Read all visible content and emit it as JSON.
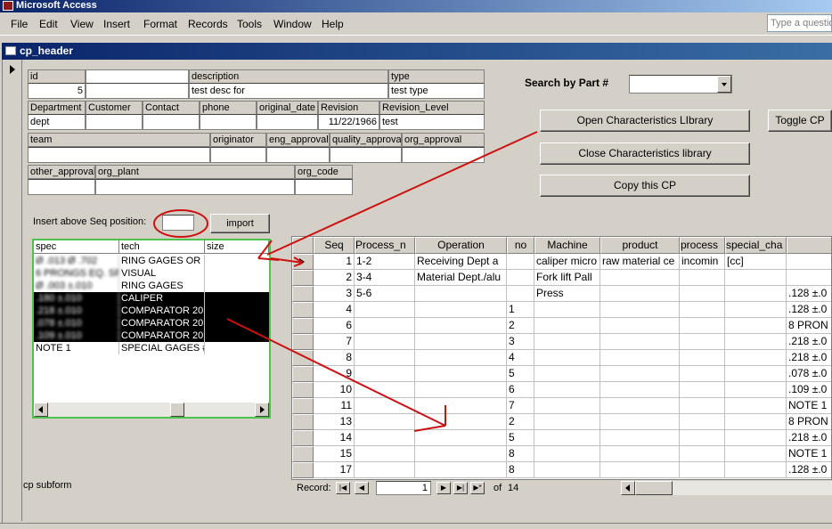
{
  "app": {
    "title": "Microsoft Access",
    "help_placeholder": "Type a questio"
  },
  "menu": [
    {
      "label": "File"
    },
    {
      "label": "Edit"
    },
    {
      "label": "View"
    },
    {
      "label": "Insert"
    },
    {
      "label": "Format"
    },
    {
      "label": "Records"
    },
    {
      "label": "Tools"
    },
    {
      "label": "Window"
    },
    {
      "label": "Help"
    }
  ],
  "window": {
    "title": "cp_header"
  },
  "header": {
    "labels": {
      "id": "id",
      "description": "description",
      "type": "type",
      "department": "Department",
      "customer": "Customer",
      "contact": "Contact",
      "phone": "phone",
      "original_date": "original_date",
      "revision": "Revision",
      "revision_level": "Revision_Level",
      "team": "team",
      "originator": "originator",
      "eng_approval": "eng_approval",
      "quality_approval": "quality_approval",
      "org_approval": "org_approval",
      "other_approval": "other_approval",
      "org_plant": "org_plant",
      "org_code": "org_code"
    },
    "values": {
      "id": "5",
      "part_no": "",
      "part_no_2": "",
      "description": "test desc for",
      "type": "test type",
      "department": "dept",
      "customer": "",
      "contact": "",
      "phone": "",
      "original_date": "",
      "revision": "11/22/1966",
      "revision_level": "test",
      "team": "",
      "originator": "",
      "eng_approval": "",
      "quality_approval": "",
      "org_approval": "",
      "other_approval": "",
      "org_plant": "",
      "org_code": ""
    }
  },
  "search": {
    "label": "Search by Part #",
    "value": ""
  },
  "buttons": {
    "open_library": "Open Characteristics LIbrary",
    "close_library": "Close Characteristics library",
    "copy_cp": "Copy this CP",
    "toggle_cp": "Toggle CP",
    "import": "import"
  },
  "insert": {
    "label": "Insert above Seq position:",
    "value": ""
  },
  "listbox": {
    "columns": [
      "spec",
      "tech",
      "size"
    ],
    "rows": [
      {
        "spec": "Ø .013 Ø .702",
        "tech": "RING GAGES OR I",
        "size": "",
        "selected": false,
        "blurred": true
      },
      {
        "spec": "6 PRONGS EQ. SF",
        "tech": "VISUAL",
        "size": "",
        "selected": false,
        "blurred": true
      },
      {
        "spec": "Ø .003 ±.010",
        "tech": "RING GAGES",
        "size": "",
        "selected": false,
        "blurred": true
      },
      {
        "spec": ".180 ±.010",
        "tech": "CALIPER",
        "size": "",
        "selected": true,
        "blurred": true
      },
      {
        "spec": ".218 ±.010",
        "tech": "COMPARATOR 20",
        "size": "",
        "selected": true,
        "blurred": true
      },
      {
        "spec": ".078 ±.010",
        "tech": "COMPARATOR 20",
        "size": "",
        "selected": true,
        "blurred": true
      },
      {
        "spec": ".109 ±.010",
        "tech": "COMPARATOR 20",
        "size": "",
        "selected": true,
        "blurred": true
      },
      {
        "spec": "NOTE 1",
        "tech": "SPECIAL GAGES #",
        "size": "",
        "selected": false,
        "blurred": false
      }
    ]
  },
  "subform_label": "cp subform",
  "grid": {
    "columns": [
      "Seq",
      "Process_n",
      "Operation",
      "no",
      "Machine",
      "product",
      "process",
      "special_cha",
      ""
    ],
    "rows": [
      {
        "seq": "1",
        "process": "1-2",
        "operation": "Receiving Dept a",
        "no": "",
        "machine": "caliper micro",
        "product": "raw material ce",
        "proc": "incomin",
        "special": "[cc]",
        "spec": "",
        "current": true
      },
      {
        "seq": "2",
        "process": "3-4",
        "operation": "Material Dept./alu",
        "no": "",
        "machine": "Fork lift Pall",
        "product": "",
        "proc": "",
        "special": "",
        "spec": "",
        "current": false
      },
      {
        "seq": "3",
        "process": "5-6",
        "operation": "",
        "no": "",
        "machine": "Press",
        "product": "",
        "proc": "",
        "special": "",
        "spec": ".128 ±.0",
        "current": false
      },
      {
        "seq": "4",
        "process": "",
        "operation": "",
        "no": "1",
        "machine": "",
        "product": "",
        "proc": "",
        "special": "",
        "spec": ".128 ±.0",
        "current": false
      },
      {
        "seq": "6",
        "process": "",
        "operation": "",
        "no": "2",
        "machine": "",
        "product": "",
        "proc": "",
        "special": "",
        "spec": "8 PRON",
        "current": false
      },
      {
        "seq": "7",
        "process": "",
        "operation": "",
        "no": "3",
        "machine": "",
        "product": "",
        "proc": "",
        "special": "",
        "spec": ".218 ±.0",
        "current": false
      },
      {
        "seq": "8",
        "process": "",
        "operation": "",
        "no": "4",
        "machine": "",
        "product": "",
        "proc": "",
        "special": "",
        "spec": ".218 ±.0",
        "current": false
      },
      {
        "seq": "9",
        "process": "",
        "operation": "",
        "no": "5",
        "machine": "",
        "product": "",
        "proc": "",
        "special": "",
        "spec": ".078 ±.0",
        "current": false
      },
      {
        "seq": "10",
        "process": "",
        "operation": "",
        "no": "6",
        "machine": "",
        "product": "",
        "proc": "",
        "special": "",
        "spec": ".109 ±.0",
        "current": false
      },
      {
        "seq": "11",
        "process": "",
        "operation": "",
        "no": "7",
        "machine": "",
        "product": "",
        "proc": "",
        "special": "",
        "spec": "NOTE 1",
        "current": false
      },
      {
        "seq": "13",
        "process": "",
        "operation": "",
        "no": "2",
        "machine": "",
        "product": "",
        "proc": "",
        "special": "",
        "spec": "8 PRON",
        "current": false
      },
      {
        "seq": "14",
        "process": "",
        "operation": "",
        "no": "5",
        "machine": "",
        "product": "",
        "proc": "",
        "special": "",
        "spec": ".218 ±.0",
        "current": false
      },
      {
        "seq": "15",
        "process": "",
        "operation": "",
        "no": "8",
        "machine": "",
        "product": "",
        "proc": "",
        "special": "",
        "spec": "NOTE 1",
        "current": false
      },
      {
        "seq": "17",
        "process": "",
        "operation": "",
        "no": "8",
        "machine": "",
        "product": "",
        "proc": "",
        "special": "",
        "spec": ".128 ±.0",
        "current": false
      }
    ]
  },
  "record_nav": {
    "label": "Record:",
    "current": "1",
    "of_label": "of",
    "total": "14"
  },
  "annotation_color": "#cc1111"
}
